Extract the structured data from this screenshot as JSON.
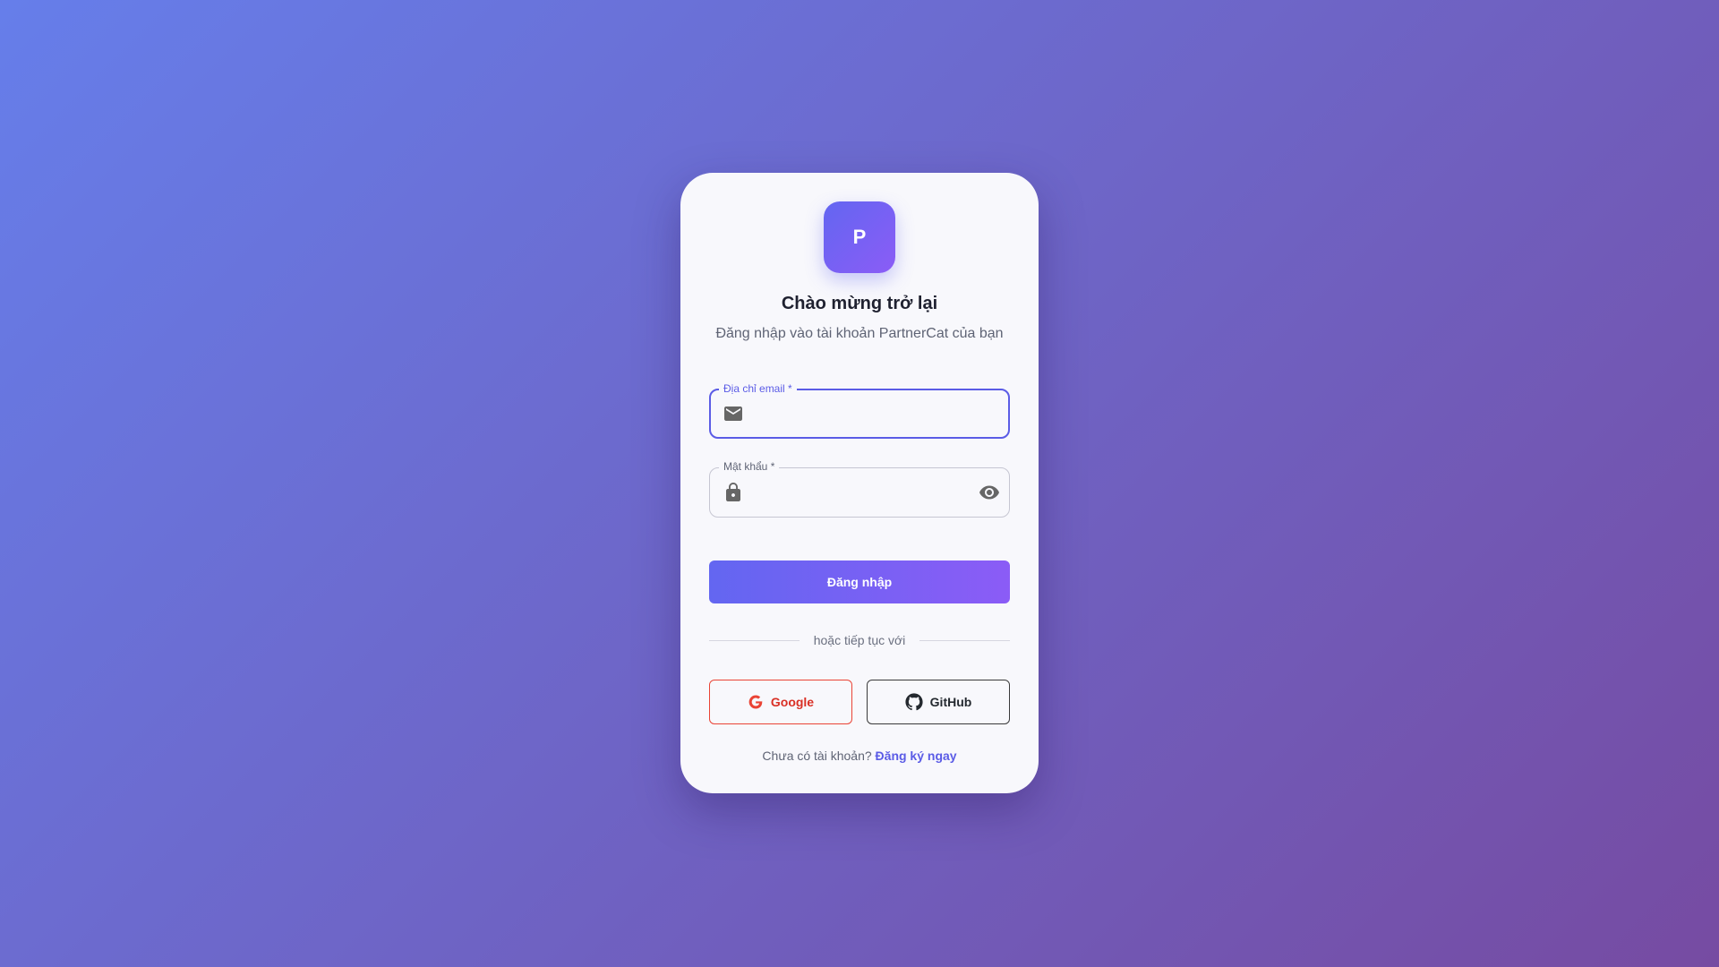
{
  "brand": {
    "logo_letter": "P",
    "accent_start": "#6366f1",
    "accent_end": "#8b5cf6"
  },
  "header": {
    "title": "Chào mừng trở lại",
    "subtitle": "Đăng nhập vào tài khoản PartnerCat của bạn"
  },
  "form": {
    "email": {
      "label": "Địa chỉ email *",
      "value": "",
      "icon": "mail-icon"
    },
    "password": {
      "label": "Mật khẩu *",
      "value": "",
      "icon": "lock-icon",
      "toggle_icon": "eye-icon"
    },
    "submit_label": "Đăng nhập"
  },
  "divider": {
    "text": "hoặc tiếp tục với"
  },
  "social": {
    "google_label": "Google",
    "github_label": "GitHub",
    "google_color": "#ea4335",
    "github_color": "#24292f"
  },
  "footer": {
    "prompt": "Chưa có tài khoản?",
    "link_label": "Đăng ký ngay"
  }
}
